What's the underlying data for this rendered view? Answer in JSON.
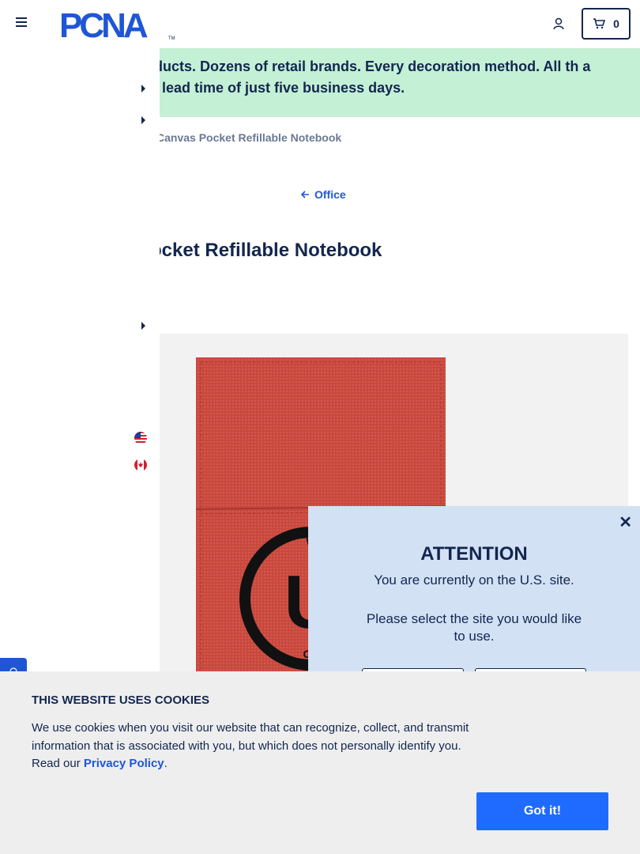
{
  "header": {
    "logo_text": "PCNA",
    "logo_tm": "TM",
    "cart_count": "0"
  },
  "banner": {
    "text": "ls of products. Dozens of retail brands. Every decoration method. All th a standard lead time of just five business days."
  },
  "breadcrumb": {
    "current": "Canvas Pocket Refillable Notebook"
  },
  "back_link": {
    "label": "Office"
  },
  "product": {
    "title": "ocket Refillable Notebook",
    "image_icon": "red-canvas-notebook-image"
  },
  "drawer": {
    "flags": [
      "us-flag-icon",
      "canada-flag-icon"
    ]
  },
  "modal": {
    "title": "ATTENTION",
    "line1": "You are currently on the U.S. site.",
    "line2": "Please select the site you would like to use."
  },
  "cookie": {
    "title": "THIS WEBSITE USES COOKIES",
    "text": "We use cookies when you visit our website that can recognize, collect, and transmit information that is associated with you, but which does not personally identify you. Read our",
    "link": "Privacy Policy",
    "period": ".",
    "button": "Got it!"
  },
  "colors": {
    "navy": "#13264f",
    "blue": "#1f56d6",
    "banner_green": "#c4f0d5",
    "modal_bg": "#d3e1f5",
    "notebook_red": "#c9483d"
  }
}
